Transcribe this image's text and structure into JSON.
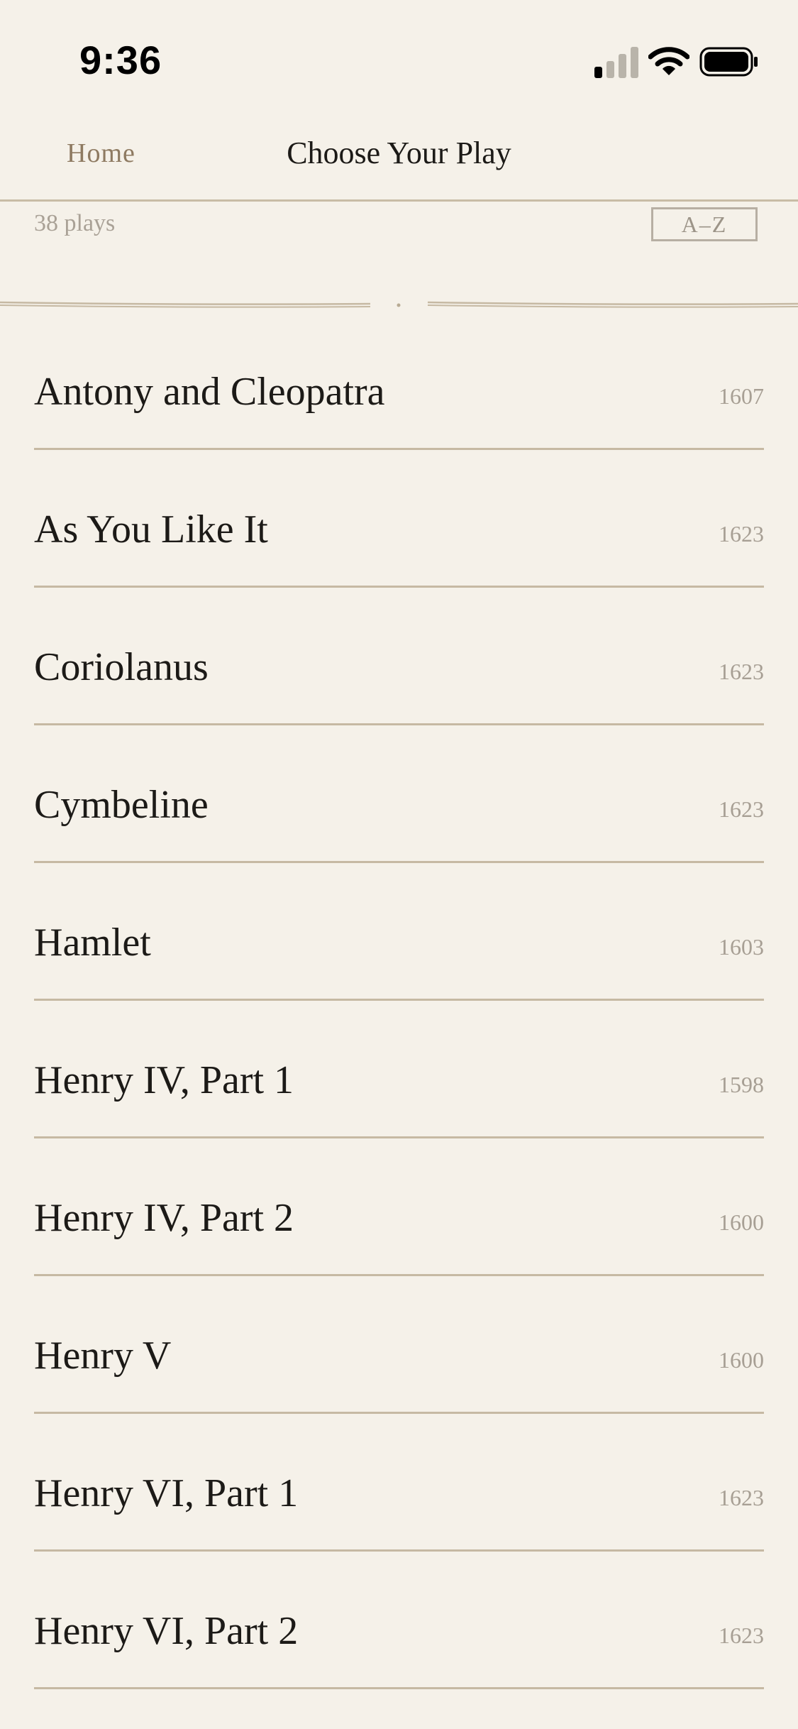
{
  "status_bar": {
    "time": "9:36",
    "signal_icon": "cellular-signal-icon",
    "wifi_icon": "wifi-icon",
    "battery_icon": "battery-icon"
  },
  "nav": {
    "back_label": "Home",
    "title": "Choose Your Play"
  },
  "list_header": {
    "count": "38 plays",
    "sort_label": "A–Z"
  },
  "plays": [
    {
      "title": "Antony and Cleopatra",
      "year": "1607"
    },
    {
      "title": "As You Like It",
      "year": "1623"
    },
    {
      "title": "Coriolanus",
      "year": "1623"
    },
    {
      "title": "Cymbeline",
      "year": "1623"
    },
    {
      "title": "Hamlet",
      "year": "1603"
    },
    {
      "title": "Henry IV, Part 1",
      "year": "1598"
    },
    {
      "title": "Henry IV, Part 2",
      "year": "1600"
    },
    {
      "title": "Henry V",
      "year": "1600"
    },
    {
      "title": "Henry VI, Part 1",
      "year": "1623"
    },
    {
      "title": "Henry VI, Part 2",
      "year": "1623"
    }
  ],
  "colors": {
    "background": "#f5f1e9",
    "accent": "#8e7a61",
    "divider": "#c6b9a3",
    "muted_text": "#a79f94"
  }
}
